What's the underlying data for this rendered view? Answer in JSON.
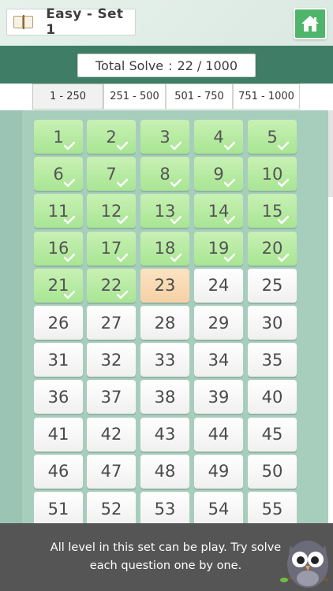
{
  "header": {
    "set_title": "Easy - Set 1",
    "book_icon": "book-icon",
    "home_icon": "home-icon"
  },
  "progress": {
    "label": "Total Solve",
    "separator": ":",
    "solved": "22",
    "slash": "/",
    "total": "1000"
  },
  "tabs": [
    {
      "label": "1 - 250",
      "active": true
    },
    {
      "label": "251 - 500",
      "active": false
    },
    {
      "label": "501 - 750",
      "active": false
    },
    {
      "label": "751 - 1000",
      "active": false
    }
  ],
  "levels": {
    "visible": [
      "1",
      "2",
      "3",
      "4",
      "5",
      "6",
      "7",
      "8",
      "9",
      "10",
      "11",
      "12",
      "13",
      "14",
      "15",
      "16",
      "17",
      "18",
      "19",
      "20",
      "21",
      "22",
      "23",
      "24",
      "25",
      "26",
      "27",
      "28",
      "29",
      "30",
      "31",
      "32",
      "33",
      "34",
      "35",
      "36",
      "37",
      "38",
      "39",
      "40",
      "41",
      "42",
      "43",
      "44",
      "45",
      "46",
      "47",
      "48",
      "49",
      "50",
      "51",
      "52",
      "53",
      "54",
      "55"
    ],
    "solved_count": 22,
    "current_level": 23
  },
  "footer": {
    "message": "All level in this set can be play. Try solve each question one by one."
  },
  "colors": {
    "header_band": "#3f7d66",
    "solved_tile": "#a8e593",
    "current_tile": "#f6d0a6",
    "open_tile": "#ffffff",
    "home_button": "#4fb56a",
    "footer_bg": "#555555"
  }
}
